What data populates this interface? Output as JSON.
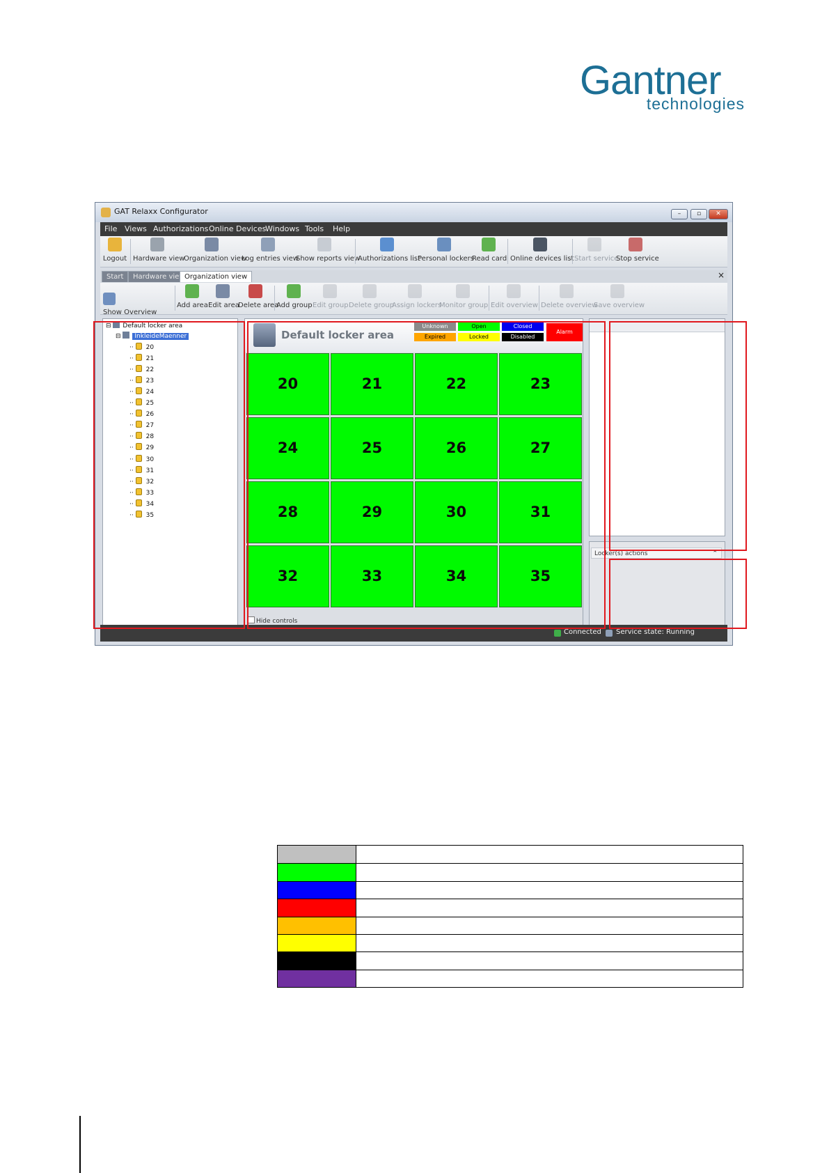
{
  "logo": {
    "brand": "Gantner",
    "sub": "technologies"
  },
  "window": {
    "title": "GAT Relaxx Configurator",
    "controls": {
      "minimize": "–",
      "maximize": "▫",
      "close": "✕"
    },
    "menu": [
      "File",
      "Views",
      "Authorizations",
      "Online Devices",
      "Windows",
      "Tools",
      "Help"
    ],
    "toolbar": [
      {
        "label": "Logout",
        "icon": "key-icon",
        "enabled": true
      },
      {
        "label": "Hardware view",
        "icon": "hardware-icon",
        "enabled": true
      },
      {
        "label": "Organization view",
        "icon": "building-icon",
        "enabled": true
      },
      {
        "label": "Log entries view",
        "icon": "log-icon",
        "enabled": true
      },
      {
        "label": "Show reports view",
        "icon": "report-icon",
        "enabled": true
      },
      {
        "label": "Authorizations list",
        "icon": "auth-icon",
        "enabled": true
      },
      {
        "label": "Personal lockers",
        "icon": "person-icon",
        "enabled": true
      },
      {
        "label": "Read card",
        "icon": "card-icon",
        "enabled": true
      },
      {
        "label": "Online devices list",
        "icon": "device-icon",
        "enabled": true
      },
      {
        "label": "Start service",
        "icon": "gear-icon",
        "enabled": false
      },
      {
        "label": "Stop service",
        "icon": "gear-stop-icon",
        "enabled": true
      }
    ],
    "tabs": [
      {
        "label": "Start",
        "active": false
      },
      {
        "label": "Hardware view",
        "active": false
      },
      {
        "label": "Organization view",
        "active": true
      }
    ],
    "tab_close": "×",
    "toolbar2": [
      {
        "label": "Show Overview",
        "icon": "overview-icon",
        "enabled": true
      },
      {
        "label": "Add area",
        "icon": "add-area-icon",
        "enabled": true
      },
      {
        "label": "Edit area",
        "icon": "edit-area-icon",
        "enabled": true
      },
      {
        "label": "Delete area",
        "icon": "delete-area-icon",
        "enabled": true
      },
      {
        "label": "Add group",
        "icon": "add-group-icon",
        "enabled": true
      },
      {
        "label": "Edit group",
        "icon": "edit-group-icon",
        "enabled": false
      },
      {
        "label": "Delete group",
        "icon": "delete-group-icon",
        "enabled": false
      },
      {
        "label": "Assign lockers",
        "icon": "assign-icon",
        "enabled": false
      },
      {
        "label": "Monitor group",
        "icon": "monitor-icon",
        "enabled": false
      },
      {
        "label": "Edit overview",
        "icon": "edit-overview-icon",
        "enabled": false
      },
      {
        "label": "Delete overview",
        "icon": "trash-icon",
        "enabled": false
      },
      {
        "label": "Save overview",
        "icon": "save-icon",
        "enabled": false
      }
    ],
    "tree": {
      "root": "Default locker area",
      "group": "InkleideMaenner",
      "lockers": [
        "20",
        "21",
        "22",
        "23",
        "24",
        "25",
        "26",
        "27",
        "28",
        "29",
        "30",
        "31",
        "32",
        "33",
        "34",
        "35"
      ]
    },
    "area_title": "Default locker area",
    "status_legend": [
      {
        "label": "Unknown",
        "color": "#8a8a8a",
        "text": "#ffffff"
      },
      {
        "label": "Open",
        "color": "#00ff00",
        "text": "#000000"
      },
      {
        "label": "Closed",
        "color": "#0000ee",
        "text": "#ffffff"
      },
      {
        "label": "Expired",
        "color": "#ffa500",
        "text": "#000000"
      },
      {
        "label": "Locked",
        "color": "#ffff00",
        "text": "#000000"
      },
      {
        "label": "Disabled",
        "color": "#000000",
        "text": "#ffffff"
      }
    ],
    "alarm": {
      "label": "Alarm",
      "color": "#ff0000"
    },
    "grid_cells": [
      "20",
      "21",
      "22",
      "23",
      "24",
      "25",
      "26",
      "27",
      "28",
      "29",
      "30",
      "31",
      "32",
      "33",
      "34",
      "35"
    ],
    "cell_color": "#00fa00",
    "hide_controls": "Hide controls",
    "locker_actions": "Locker(s) actions",
    "status": {
      "connected": "Connected",
      "service": "Service state: Running"
    }
  },
  "color_legend": [
    "#c0c0c0",
    "#00ff00",
    "#0000ff",
    "#ff0000",
    "#ffc000",
    "#ffff00",
    "#000000",
    "#7030a0"
  ]
}
